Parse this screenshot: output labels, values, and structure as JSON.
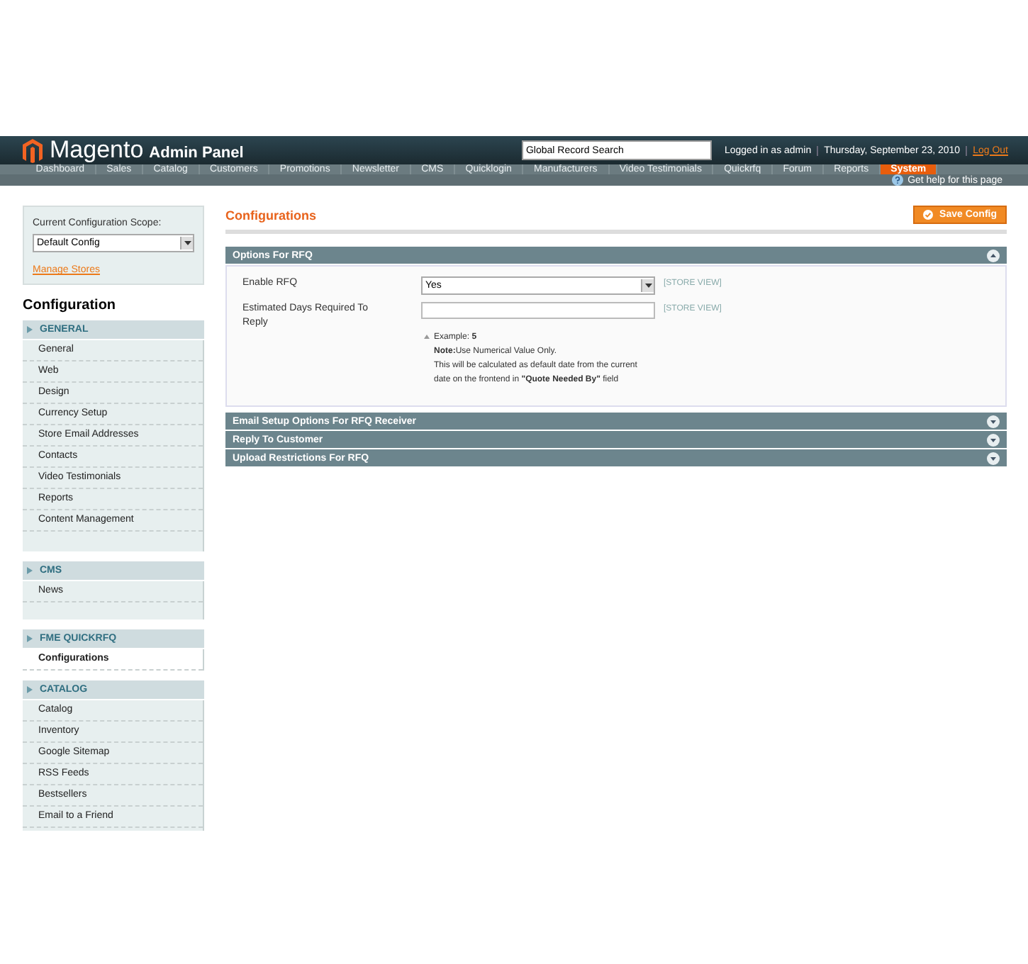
{
  "header": {
    "logo": "Magento",
    "logo_sub": "Admin Panel",
    "search": {
      "value": "Global Record Search"
    },
    "user": "Logged in as admin",
    "date": "Thursday, September 23, 2010",
    "logout": "Log Out"
  },
  "nav": [
    {
      "label": "Dashboard",
      "selected": false
    },
    {
      "label": "Sales",
      "selected": false
    },
    {
      "label": "Catalog",
      "selected": false
    },
    {
      "label": "Customers",
      "selected": false
    },
    {
      "label": "Promotions",
      "selected": false
    },
    {
      "label": "Newsletter",
      "selected": false
    },
    {
      "label": "CMS",
      "selected": false
    },
    {
      "label": "Quicklogin",
      "selected": false
    },
    {
      "label": "Manufacturers",
      "selected": false
    },
    {
      "label": "Video Testimonials",
      "selected": false
    },
    {
      "label": "Quickrfq",
      "selected": false
    },
    {
      "label": "Forum",
      "selected": false
    },
    {
      "label": "Reports",
      "selected": false
    },
    {
      "label": "System",
      "selected": true
    }
  ],
  "help": "Get help for this page",
  "sidebar": {
    "scope_label": "Current Configuration Scope:",
    "scope_value": "Default Config",
    "manage": "Manage Stores",
    "title": "Configuration",
    "groups": [
      {
        "label": "GENERAL",
        "items": [
          {
            "label": "General",
            "selected": false
          },
          {
            "label": "Web",
            "selected": false
          },
          {
            "label": "Design",
            "selected": false
          },
          {
            "label": "Currency Setup",
            "selected": false
          },
          {
            "label": "Store Email Addresses",
            "selected": false
          },
          {
            "label": "Contacts",
            "selected": false
          },
          {
            "label": "Video Testimonials",
            "selected": false
          },
          {
            "label": "Reports",
            "selected": false
          },
          {
            "label": "Content Management",
            "selected": false
          }
        ]
      },
      {
        "label": "CMS",
        "items": [
          {
            "label": "News",
            "selected": false
          }
        ]
      },
      {
        "label": "FME QUICKRFQ",
        "items": [
          {
            "label": "Configurations",
            "selected": true
          }
        ]
      },
      {
        "label": "CATALOG",
        "items": [
          {
            "label": "Catalog",
            "selected": false
          },
          {
            "label": "Inventory",
            "selected": false
          },
          {
            "label": "Google Sitemap",
            "selected": false
          },
          {
            "label": "RSS Feeds",
            "selected": false
          },
          {
            "label": "Bestsellers",
            "selected": false
          },
          {
            "label": "Email to a Friend",
            "selected": false
          }
        ]
      }
    ]
  },
  "content": {
    "title": "Configurations",
    "save": "Save Config",
    "sections": [
      {
        "title": "Options For RFQ",
        "expanded": true,
        "fields": [
          {
            "kind": "select",
            "label": "Enable RFQ",
            "value": "Yes",
            "scope": "[STORE VIEW]"
          },
          {
            "kind": "text",
            "label": "Estimated Days Required To Reply",
            "scope": "[STORE VIEW]",
            "comment": [
              "Example: **5**",
              "**Note:**Use Numerical Value Only.",
              "This will be calculated as default date from the current",
              "date on the frontend in **\"Quote Needed By\"** field"
            ]
          }
        ]
      },
      {
        "title": "Email Setup Options For RFQ Receiver",
        "expanded": false
      },
      {
        "title": "Reply To Customer",
        "expanded": false
      },
      {
        "title": "Upload Restrictions For RFQ",
        "expanded": false
      }
    ]
  }
}
